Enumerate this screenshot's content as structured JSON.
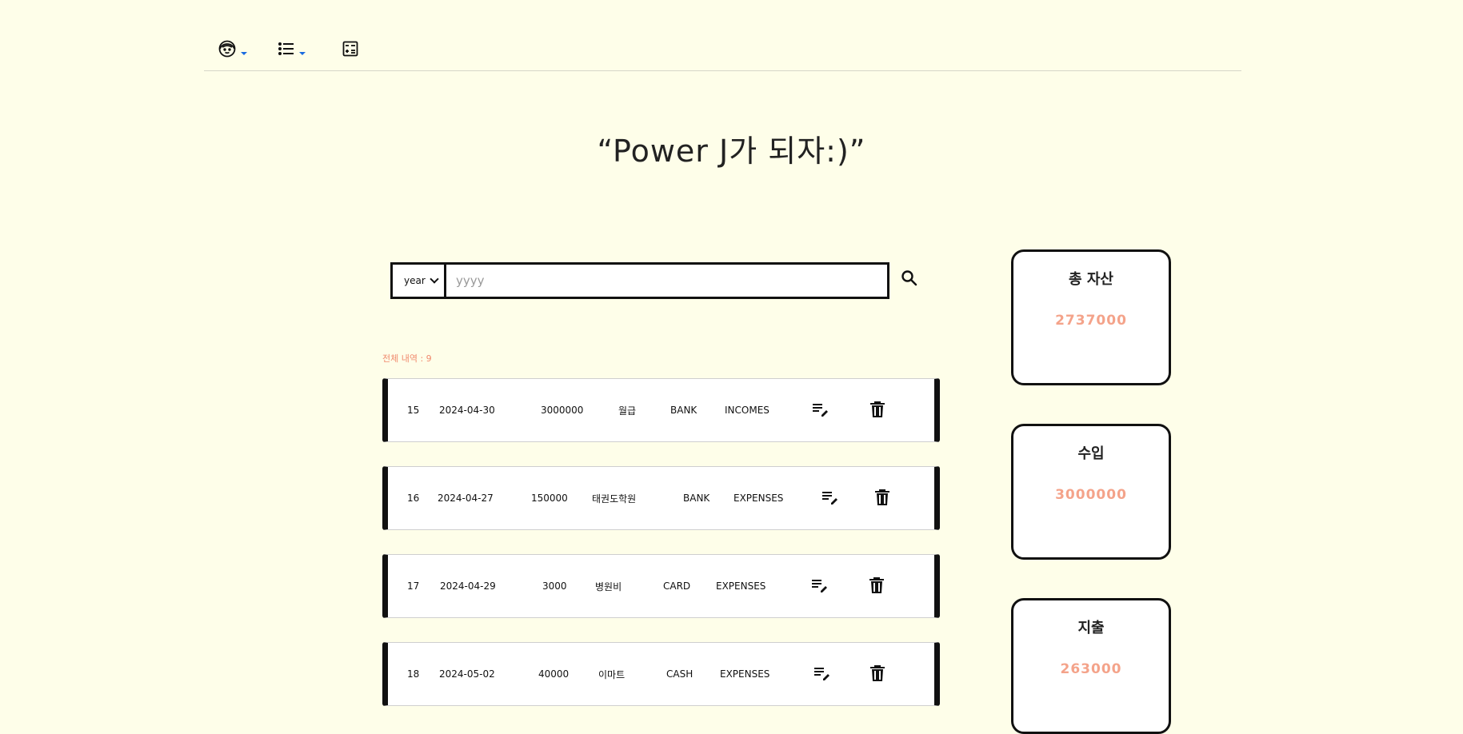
{
  "nav": {
    "icons": [
      "profile-icon",
      "list-icon",
      "calculator-icon"
    ]
  },
  "page": {
    "title": "“Power J가 되자:)”"
  },
  "search": {
    "select_value": "year",
    "placeholder": "yyyy",
    "value": ""
  },
  "summary": {
    "total_count_label": "전체 내역 : 9"
  },
  "records": [
    {
      "id": "15",
      "date": "2024-04-30",
      "amount": "3000000",
      "memo": "월급",
      "payment": "BANK",
      "type": "INCOMES"
    },
    {
      "id": "16",
      "date": "2024-04-27",
      "amount": "150000",
      "memo": "태권도학원",
      "payment": "BANK",
      "type": "EXPENSES"
    },
    {
      "id": "17",
      "date": "2024-04-29",
      "amount": "3000",
      "memo": "병원비",
      "payment": "CARD",
      "type": "EXPENSES"
    },
    {
      "id": "18",
      "date": "2024-05-02",
      "amount": "40000",
      "memo": "이마트",
      "payment": "CASH",
      "type": "EXPENSES"
    }
  ],
  "cards": [
    {
      "title": "총 자산",
      "value": "2737000"
    },
    {
      "title": "수입",
      "value": "3000000"
    },
    {
      "title": "지출",
      "value": "263000"
    }
  ],
  "colors": {
    "background": "#fefee9",
    "accent": "#f4a38a",
    "count_text": "#f08a6e",
    "caret": "#1a6be0"
  }
}
